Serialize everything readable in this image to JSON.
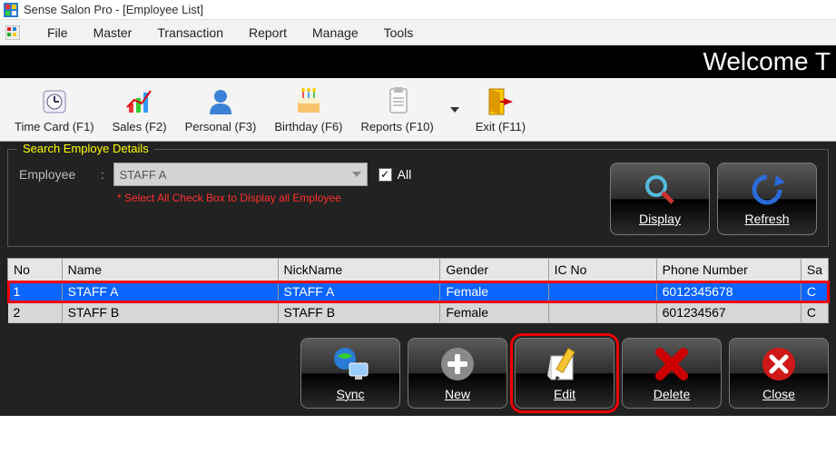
{
  "window": {
    "title": "Sense Salon Pro - [Employee List]"
  },
  "menubar": {
    "items": [
      "File",
      "Master",
      "Transaction",
      "Report",
      "Manage",
      "Tools"
    ]
  },
  "welcome": "Welcome T",
  "toolbar": {
    "items": [
      {
        "label": "Time Card (F1)",
        "icon": "timecard-icon"
      },
      {
        "label": "Sales (F2)",
        "icon": "sales-icon"
      },
      {
        "label": "Personal (F3)",
        "icon": "personal-icon"
      },
      {
        "label": "Birthday (F6)",
        "icon": "birthday-icon"
      },
      {
        "label": "Reports (F10)",
        "icon": "reports-icon"
      },
      {
        "label": "Exit (F11)",
        "icon": "exit-icon"
      }
    ]
  },
  "search": {
    "legend": "Search Employe Details",
    "employee_label": "Employee",
    "employee_value": "STAFF A",
    "all_label": "All",
    "all_checked": true,
    "hint": "* Select All Check Box to Display all Employee",
    "display_label": "Display",
    "refresh_label": "Refresh"
  },
  "table": {
    "columns": [
      "No",
      "Name",
      "NickName",
      "Gender",
      "IC No",
      "Phone Number",
      "Sa"
    ],
    "rows": [
      {
        "no": "1",
        "name": "STAFF A",
        "nick": "STAFF A",
        "gender": "Female",
        "ic": "",
        "phone": "6012345678",
        "sa": "C",
        "selected": true
      },
      {
        "no": "2",
        "name": "STAFF B",
        "nick": "STAFF B",
        "gender": "Female",
        "ic": "",
        "phone": "601234567",
        "sa": "C",
        "selected": false
      }
    ]
  },
  "footer": {
    "sync": "Sync",
    "new": "New",
    "edit": "Edit",
    "delete": "Delete",
    "close": "Close"
  }
}
